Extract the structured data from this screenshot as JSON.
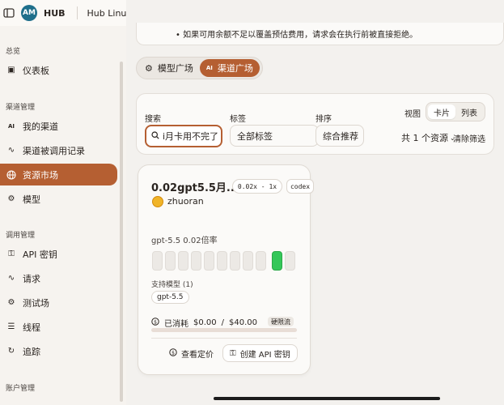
{
  "header": {
    "sidebar_toggle_icon": "sidebar-toggle-icon",
    "brand": "HUB",
    "workspace": "Hub Linux Do",
    "translate_icon": "translate-icon",
    "theme_icon": "sun-icon"
  },
  "sidebar": {
    "group_overview": "总览",
    "group_channels": "渠道管理",
    "group_usage": "调用管理",
    "group_account": "账户管理",
    "items": [
      {
        "label": "仪表板",
        "icon": "dashboard-icon"
      },
      {
        "label": "我的渠道",
        "icon": "ai-icon"
      },
      {
        "label": "渠道被调用记录",
        "icon": "activity-icon"
      },
      {
        "label": "资源市场",
        "icon": "globe-icon"
      },
      {
        "label": "模型",
        "icon": "robot-icon"
      },
      {
        "label": "API 密钥",
        "icon": "key-icon"
      },
      {
        "label": "请求",
        "icon": "activity-icon"
      },
      {
        "label": "测试场",
        "icon": "robot-icon"
      },
      {
        "label": "线程",
        "icon": "list-icon"
      },
      {
        "label": "追踪",
        "icon": "refresh-icon"
      }
    ]
  },
  "notice": {
    "text": "如果可用余额不足以覆盖预估费用，请求会在执行前被直接拒绝。"
  },
  "tabs": [
    {
      "label": "模型广场",
      "icon": "robot-icon"
    },
    {
      "label": "渠道广场",
      "icon": "ai-icon"
    }
  ],
  "filters": {
    "search_label": "搜索",
    "search_value": "i月卡用不完了",
    "tag_label": "标签",
    "tag_value": "全部标签",
    "sort_label": "排序",
    "sort_value": "综合推荐",
    "view_label": "视图",
    "view_card": "卡片",
    "view_list": "列表",
    "count_text": "共 1 个资源",
    "clear": "清除筛选"
  },
  "card": {
    "title": "0.02gpt5.5月...",
    "rate_pill": "0.02x - 1x",
    "type_pill": "codex",
    "owner": "zhuoran",
    "rate_label": "gpt-5.5 0.02倍率",
    "support_label": "支持模型 (1)",
    "model": "gpt-5.5",
    "spent_label": "已消耗",
    "spent": "$0.00",
    "separator": "/",
    "limit": "$40.00",
    "badge": "硬限流",
    "progress": 0,
    "view_pricing": "查看定价",
    "create_key": "创建 API 密钥"
  },
  "colors": {
    "accent": "#b55f32",
    "active_bar": "#34c759"
  }
}
